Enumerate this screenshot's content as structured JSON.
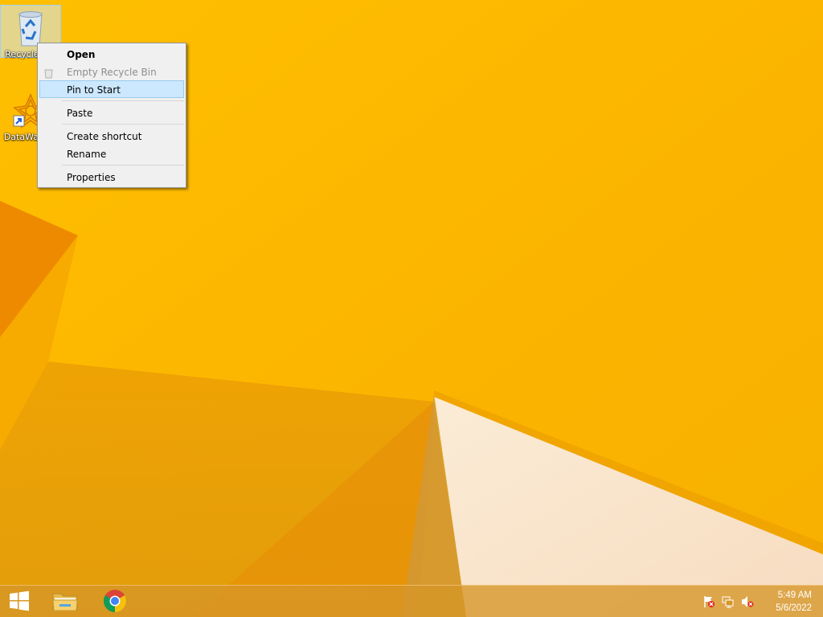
{
  "desktop": {
    "icons": [
      {
        "label": "Recycle Bin",
        "icon": "recycle-bin-icon"
      },
      {
        "label": "DataWarrior",
        "icon": "datawarrior-icon"
      }
    ]
  },
  "context_menu": {
    "items": [
      {
        "label": "Open",
        "bold": true
      },
      {
        "label": "Empty Recycle Bin",
        "disabled": true,
        "icon": "recycle-bin-small-icon"
      },
      {
        "label": "Pin to Start",
        "highlighted": true
      },
      {
        "label": "Paste"
      },
      {
        "label": "Create shortcut"
      },
      {
        "label": "Rename"
      },
      {
        "label": "Properties"
      }
    ]
  },
  "taskbar": {
    "start_icon": "windows-logo-icon",
    "pinned": [
      {
        "name": "File Explorer",
        "icon": "folder-icon"
      },
      {
        "name": "Google Chrome",
        "icon": "chrome-icon"
      }
    ],
    "tray": {
      "icons": [
        "action-center-flag-icon",
        "network-icon",
        "volume-muted-icon"
      ],
      "time": "5:49 AM",
      "date": "5/6/2022"
    }
  },
  "colors": {
    "wallpaper": "#f8b300",
    "menu_highlight": "#cce8ff",
    "taskbar": "#d69628"
  }
}
